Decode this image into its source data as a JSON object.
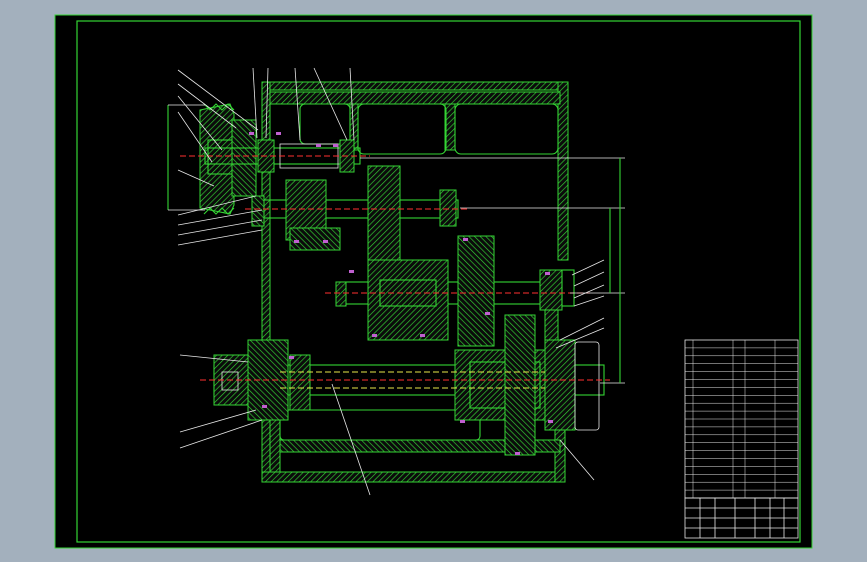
{
  "drawing": {
    "background": "#000000",
    "frame_color": "#34d534",
    "hatch_color": "#34d534",
    "centerline_color": "#ff3030",
    "dimension_color": "#34d534",
    "text_color": "#ffffff"
  },
  "parts_list": {
    "rows": 20,
    "columns": 6
  },
  "title_block": {
    "rows": 4,
    "columns": 8
  }
}
